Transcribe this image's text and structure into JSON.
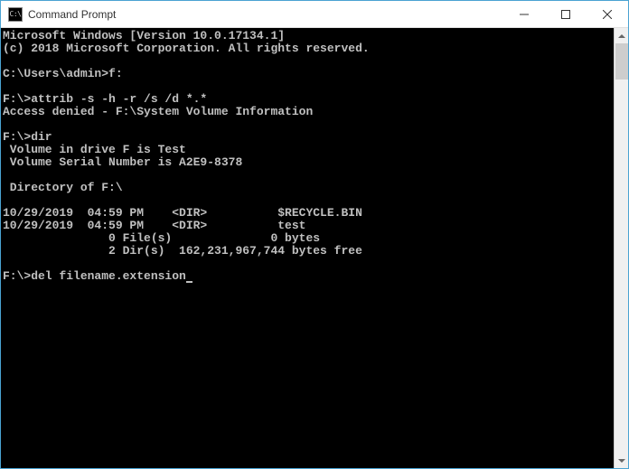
{
  "titlebar": {
    "icon_text": "C:\\",
    "title": "Command Prompt"
  },
  "terminal": {
    "lines": [
      "Microsoft Windows [Version 10.0.17134.1]",
      "(c) 2018 Microsoft Corporation. All rights reserved.",
      "",
      "C:\\Users\\admin>f:",
      "",
      "F:\\>attrib -s -h -r /s /d *.*",
      "Access denied - F:\\System Volume Information",
      "",
      "F:\\>dir",
      " Volume in drive F is Test",
      " Volume Serial Number is A2E9-8378",
      "",
      " Directory of F:\\",
      "",
      "10/29/2019  04:59 PM    <DIR>          $RECYCLE.BIN",
      "10/29/2019  04:59 PM    <DIR>          test",
      "               0 File(s)              0 bytes",
      "               2 Dir(s)  162,231,967,744 bytes free",
      "",
      "F:\\>del filename.extension"
    ]
  }
}
